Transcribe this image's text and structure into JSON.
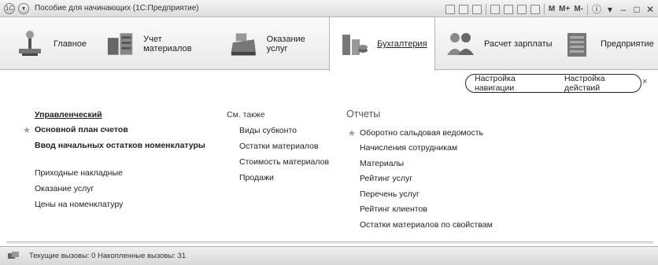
{
  "window": {
    "title": "Пособие для начинающих (1С:Предприятие)",
    "toolbar_labels": [
      "M",
      "M+",
      "M-"
    ]
  },
  "sections": [
    {
      "label": "Главное",
      "icon": "home-icon",
      "active": false
    },
    {
      "label": "Учет материалов",
      "icon": "warehouse-icon",
      "active": false
    },
    {
      "label": "Оказание услуг",
      "icon": "cash-register-icon",
      "active": false
    },
    {
      "label": "Бухгалтерия",
      "icon": "accounting-icon",
      "active": true
    },
    {
      "label": "Расчет зарплаты",
      "icon": "people-icon",
      "active": false
    },
    {
      "label": "Предприятие",
      "icon": "building-icon",
      "active": false
    }
  ],
  "navigation": {
    "settings_nav": "Настройка навигации",
    "settings_actions": "Настройка действий",
    "close": "×"
  },
  "main_links": [
    {
      "label": "Управленческий",
      "bold": true,
      "underline": true,
      "starred": false
    },
    {
      "label": "Основной план счетов",
      "bold": true,
      "underline": false,
      "starred": true
    },
    {
      "label": "Ввод начальных остатков номенклатуры",
      "bold": true,
      "underline": false,
      "starred": false
    },
    {
      "label": "Приходные накладные",
      "bold": false,
      "underline": false,
      "starred": false
    },
    {
      "label": "Оказание услуг",
      "bold": false,
      "underline": false,
      "starred": false
    },
    {
      "label": "Цены на номенклатуру",
      "bold": false,
      "underline": false,
      "starred": false
    }
  ],
  "see_also": {
    "header": "См. также",
    "items": [
      "Виды субконто",
      "Остатки материалов",
      "Стоимость материалов",
      "Продажи"
    ]
  },
  "reports": {
    "header": "Отчеты",
    "items": [
      {
        "label": "Оборотно сальдовая ведомость",
        "starred": true
      },
      {
        "label": "Начисления сотрудникам",
        "starred": false
      },
      {
        "label": "Материалы",
        "starred": false
      },
      {
        "label": "Рейтинг услуг",
        "starred": false
      },
      {
        "label": "Перечень услуг",
        "starred": false
      },
      {
        "label": "Рейтинг клиентов",
        "starred": false
      },
      {
        "label": "Остатки материалов по свойствам",
        "starred": false
      }
    ]
  },
  "statusbar": {
    "text": "Текущие вызовы: 0   Накопленные вызовы: 31"
  }
}
